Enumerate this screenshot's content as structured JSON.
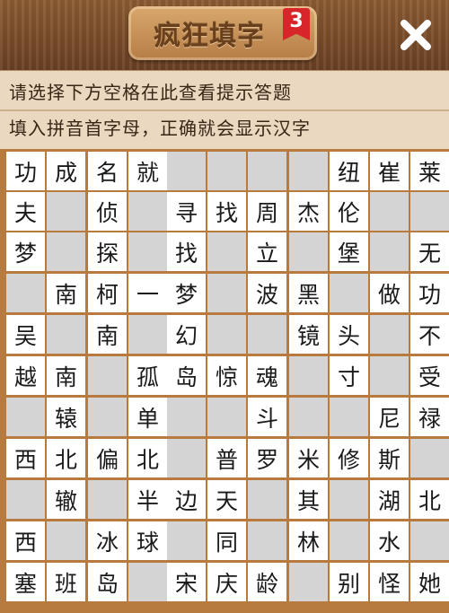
{
  "header": {
    "title": "疯狂填字",
    "level": "3",
    "close_label": "✕"
  },
  "hints": {
    "line1": "请选择下方空格在此查看提示答题",
    "line2": "填入拼音首字母，正确就会显示汉字"
  },
  "grid": {
    "rows": [
      [
        "功",
        "成",
        "名",
        "就",
        "",
        "",
        "",
        "",
        "纽",
        "崔",
        "莱"
      ],
      [
        "夫",
        "",
        "侦",
        "",
        "寻",
        "找",
        "周",
        "杰",
        "伦",
        "",
        ""
      ],
      [
        "梦",
        "",
        "探",
        "",
        "找",
        "",
        "立",
        "",
        "堡",
        "",
        "无"
      ],
      [
        "",
        "南",
        "柯",
        "一",
        "梦",
        "",
        "波",
        "黑",
        "",
        "做",
        "功"
      ],
      [
        "吴",
        "",
        "南",
        "",
        "幻",
        "",
        "",
        "镜",
        "头",
        "",
        "不"
      ],
      [
        "越",
        "南",
        "",
        "孤",
        "岛",
        "惊",
        "魂",
        "",
        "寸",
        "",
        "受"
      ],
      [
        "",
        "辕",
        "",
        "单",
        "",
        "",
        "斗",
        "",
        "",
        "尼",
        "禄"
      ],
      [
        "西",
        "北",
        "偏",
        "北",
        "",
        "普",
        "罗",
        "米",
        "修",
        "斯",
        ""
      ],
      [
        "",
        "辙",
        "",
        "半",
        "边",
        "天",
        "",
        "其",
        "",
        "湖",
        "北"
      ],
      [
        "西",
        "",
        "冰",
        "球",
        "",
        "同",
        "",
        "林",
        "",
        "水",
        ""
      ],
      [
        "塞",
        "班",
        "岛",
        "",
        "宋",
        "庆",
        "龄",
        "",
        "别",
        "怪",
        "她"
      ]
    ],
    "blank_cells": [
      [
        0,
        4
      ],
      [
        0,
        5
      ],
      [
        0,
        6
      ],
      [
        0,
        7
      ],
      [
        1,
        1
      ],
      [
        1,
        3
      ],
      [
        1,
        9
      ],
      [
        1,
        10
      ],
      [
        2,
        1
      ],
      [
        2,
        3
      ],
      [
        2,
        5
      ],
      [
        2,
        7
      ],
      [
        2,
        9
      ],
      [
        3,
        0
      ],
      [
        3,
        5
      ],
      [
        3,
        8
      ],
      [
        4,
        1
      ],
      [
        4,
        3
      ],
      [
        4,
        5
      ],
      [
        4,
        6
      ],
      [
        4,
        9
      ],
      [
        5,
        2
      ],
      [
        5,
        7
      ],
      [
        5,
        9
      ],
      [
        6,
        0
      ],
      [
        6,
        2
      ],
      [
        6,
        4
      ],
      [
        6,
        5
      ],
      [
        6,
        7
      ],
      [
        6,
        8
      ],
      [
        7,
        4
      ],
      [
        7,
        10
      ],
      [
        8,
        0
      ],
      [
        8,
        2
      ],
      [
        8,
        6
      ],
      [
        8,
        8
      ],
      [
        9,
        1
      ],
      [
        9,
        4
      ],
      [
        9,
        6
      ],
      [
        9,
        8
      ],
      [
        9,
        10
      ],
      [
        10,
        3
      ],
      [
        10,
        7
      ]
    ]
  }
}
